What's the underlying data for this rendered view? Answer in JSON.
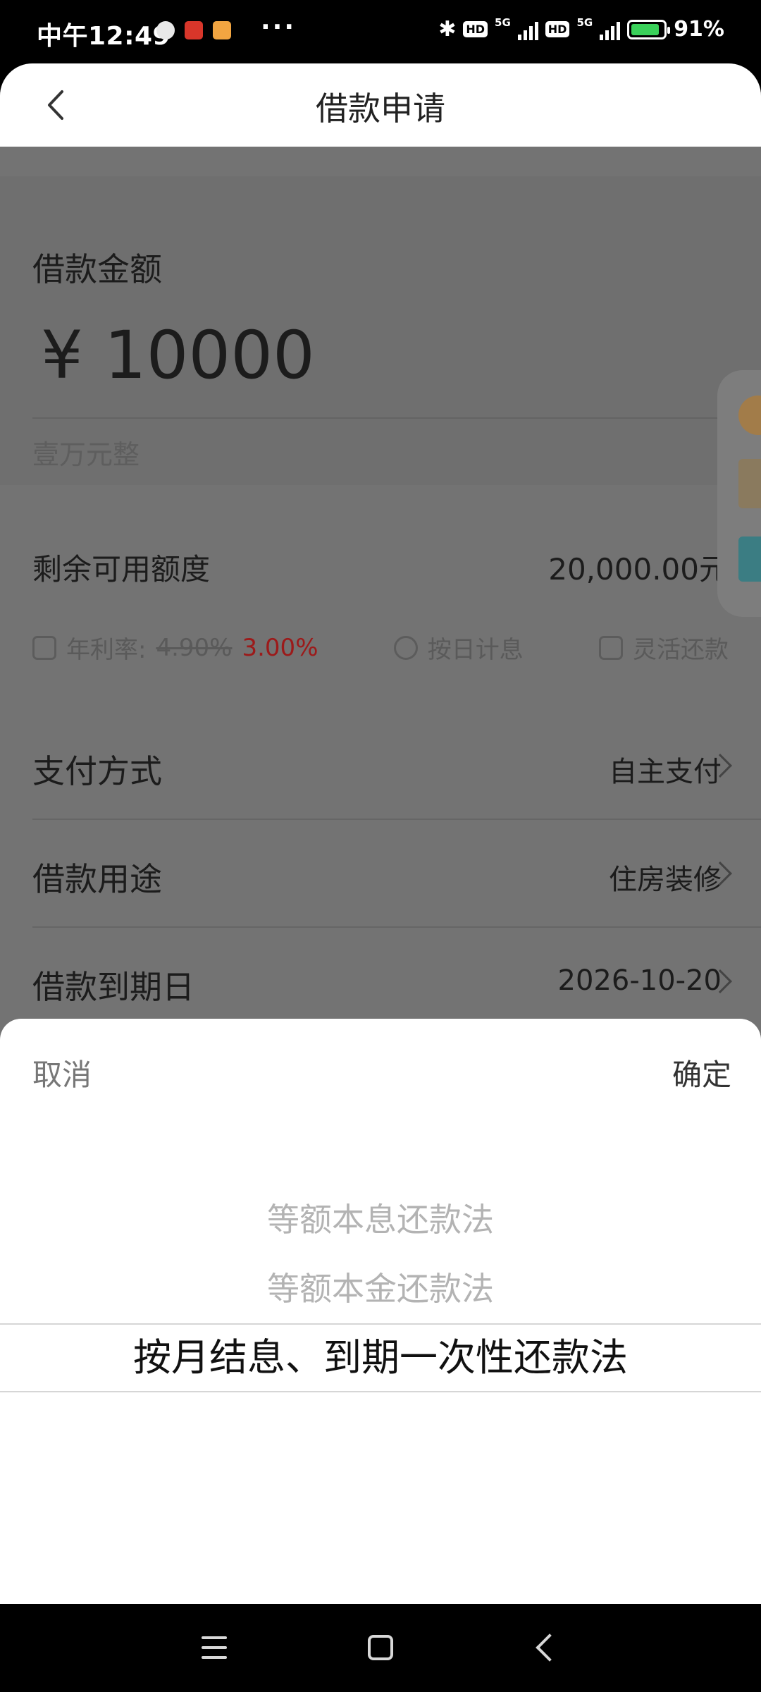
{
  "status_bar": {
    "time": "中午12:49",
    "dots": "···",
    "network_1": "5G",
    "network_2": "5G",
    "hd_1": "HD",
    "hd_2": "HD",
    "battery": "91%"
  },
  "header": {
    "title": "借款申请"
  },
  "loan": {
    "amount_label": "借款金额",
    "currency_symbol": "¥",
    "amount": "10000",
    "amount_chinese": "壹万元整",
    "quota_label": "剩余可用额度",
    "quota_value": "20,000.00元"
  },
  "tags": {
    "rate_label": "年利率:",
    "rate_old": "4.90%",
    "rate_new": "3.00%",
    "daily_interest": "按日计息",
    "flexible_repay": "灵活还款"
  },
  "rows": [
    {
      "label": "支付方式",
      "value": "自主支付"
    },
    {
      "label": "借款用途",
      "value": "住房装修"
    },
    {
      "label": "借款到期日",
      "value": "2026-10-20"
    }
  ],
  "sheet": {
    "cancel": "取消",
    "confirm": "确定",
    "options": [
      "等额本息还款法",
      "等额本金还款法",
      "按月结息、到期一次性还款法"
    ],
    "selected_index": 2
  },
  "colors": {
    "accent_rate": "#9c1a1a",
    "battery": "#3ad15a"
  }
}
